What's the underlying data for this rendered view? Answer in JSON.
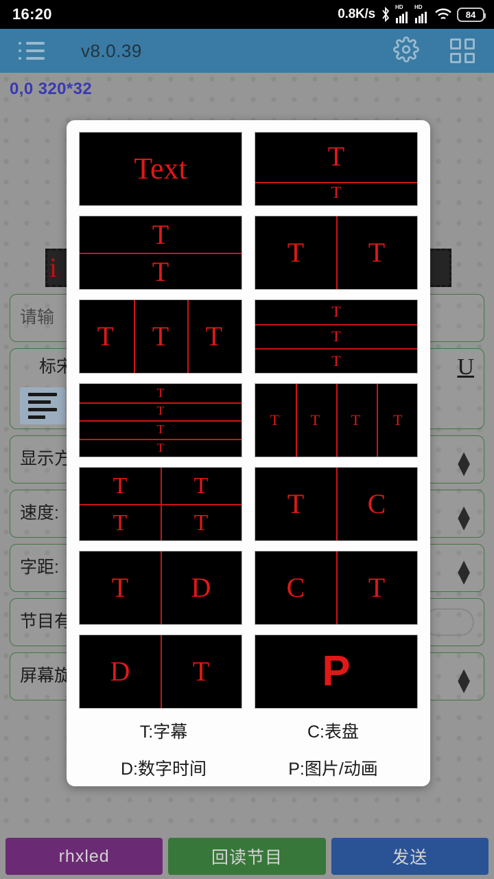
{
  "statusbar": {
    "clock": "16:20",
    "net_speed": "0.8K/s",
    "bluetooth_icon": "bluetooth-icon",
    "sim1_label": "HD",
    "sim2_label": "HD",
    "wifi_icon": "wifi-icon",
    "battery_level": "84"
  },
  "appbar": {
    "menu_icon": "list-menu-icon",
    "title": "v8.0.39",
    "settings_icon": "gear-icon",
    "grid_icon": "grid-view-icon",
    "bg_color": "#3b7ea8"
  },
  "canvas": {
    "coord_label": "0,0 320*32",
    "coord_color": "#3b3bb8",
    "chip_text": "i"
  },
  "form": {
    "rows": [
      {
        "label": "请输",
        "type": "textarea"
      },
      {
        "label": "标宋",
        "type": "font-row",
        "style_u": "U",
        "align_icon": "align-left-icon"
      },
      {
        "label": "显示方",
        "type": "spinner"
      },
      {
        "label": "速度:",
        "type": "spinner"
      },
      {
        "label": "字距:",
        "type": "spinner"
      },
      {
        "label": "节目有",
        "type": "switch"
      },
      {
        "label": "屏幕旋",
        "type": "spinner"
      }
    ]
  },
  "bottom": {
    "buttons": [
      {
        "label": "rhxled",
        "color": "#6e2b77"
      },
      {
        "label": "回读节目",
        "color": "#3a7a3c"
      },
      {
        "label": "发送",
        "color": "#2b5599"
      }
    ]
  },
  "dialog": {
    "title": "",
    "accent": "#e01818",
    "cells": [
      {
        "id": "layout-text-single",
        "name": "single-text-area",
        "labels": [
          "Text"
        ]
      },
      {
        "id": "layout-t-over-t-top",
        "name": "two-rows-large-top",
        "labels": [
          "T",
          "T"
        ]
      },
      {
        "id": "layout-t-over-t-even",
        "name": "two-rows-equal",
        "labels": [
          "T",
          "T"
        ]
      },
      {
        "id": "layout-two-col",
        "name": "two-columns",
        "labels": [
          "T",
          "T"
        ]
      },
      {
        "id": "layout-three-col",
        "name": "three-columns",
        "labels": [
          "T",
          "T",
          "T"
        ]
      },
      {
        "id": "layout-three-row",
        "name": "three-rows",
        "labels": [
          "T",
          "T",
          "T"
        ]
      },
      {
        "id": "layout-four-row",
        "name": "four-rows",
        "labels": [
          "T",
          "T",
          "T",
          "T"
        ]
      },
      {
        "id": "layout-four-col",
        "name": "four-columns",
        "labels": [
          "T",
          "T",
          "T",
          "T"
        ]
      },
      {
        "id": "layout-quad",
        "name": "two-by-two-grid",
        "labels": [
          "T",
          "T",
          "T",
          "T"
        ]
      },
      {
        "id": "layout-text-clock",
        "name": "text-left-clock-right",
        "labels": [
          "T",
          "C"
        ]
      },
      {
        "id": "layout-text-digital",
        "name": "text-left-digital-right",
        "labels": [
          "T",
          "D"
        ]
      },
      {
        "id": "layout-clock-text",
        "name": "clock-left-text-right",
        "labels": [
          "C",
          "T"
        ]
      },
      {
        "id": "layout-digital-text",
        "name": "digital-left-text-right",
        "labels": [
          "D",
          "T"
        ]
      },
      {
        "id": "layout-picture",
        "name": "picture-animation-fullscreen",
        "labels": [
          "P"
        ]
      }
    ],
    "legend": [
      "T:字幕",
      "C:表盘",
      "D:数字时间",
      "P:图片/动画"
    ]
  }
}
